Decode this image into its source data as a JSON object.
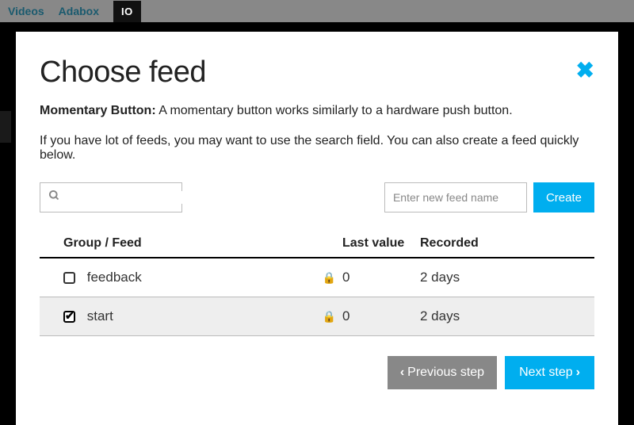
{
  "nav": {
    "items": [
      "Videos",
      "Adabox"
    ],
    "active": "IO"
  },
  "dialog": {
    "title": "Choose feed",
    "block_type_label": "Momentary Button:",
    "block_type_desc": "A momentary button works similarly to a hardware push button.",
    "help_text": "If you have lot of feeds, you may want to use the search field. You can also create a feed quickly below.",
    "new_feed_placeholder": "Enter new feed name",
    "create_label": "Create",
    "table": {
      "headers": {
        "group": "Group / Feed",
        "last": "Last value",
        "recorded": "Recorded"
      },
      "rows": [
        {
          "checked": false,
          "name": "feedback",
          "locked": true,
          "last_value": "0",
          "recorded": "2 days"
        },
        {
          "checked": true,
          "name": "start",
          "locked": true,
          "last_value": "0",
          "recorded": "2 days"
        }
      ]
    },
    "buttons": {
      "prev": "Previous step",
      "next": "Next step"
    }
  }
}
